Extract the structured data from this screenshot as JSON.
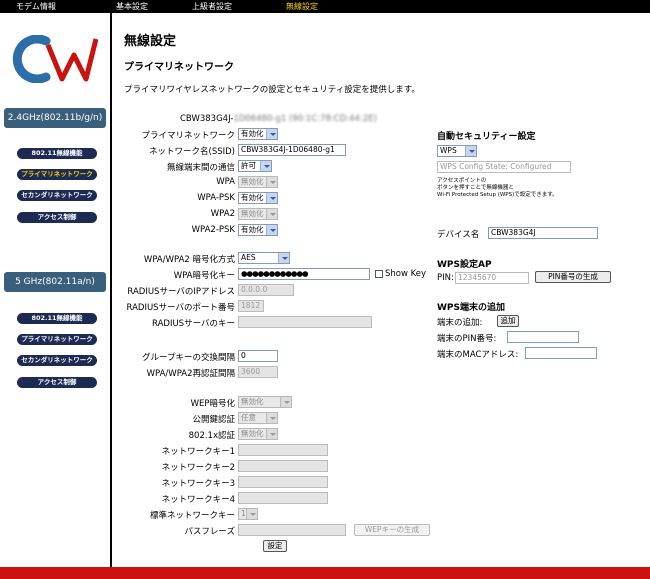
{
  "topnav": {
    "items": [
      "モデム情報",
      "基本設定",
      "上級者設定",
      "無線設定"
    ]
  },
  "logo": {
    "text": "CW",
    "color_c": "#2e6ea8",
    "color_w": "#cc1111"
  },
  "sidebar": {
    "band_24": "2.4GHz(802.11b/g/n)",
    "band_5": "5 GHz(802.11a/n)",
    "items_24": [
      "802.11無線機能",
      "プライマリネットワーク",
      "セカンダリネットワーク",
      "アクセス制御"
    ],
    "items_5": [
      "802.11無線機能",
      "プライマリネットワーク",
      "セカンダリネットワーク",
      "アクセス制御"
    ]
  },
  "page": {
    "title": "無線設定",
    "subtitle": "プライマリネットワーク",
    "description": "プライマリワイヤレスネットワークの設定とセキュリティ設定を提供します。"
  },
  "form": {
    "device_id_prefix": "CBW383G4J-",
    "device_id_blurred": "1D06480-g1 (90:1C:78:CD:44:2E)",
    "primary_network": {
      "label": "プライマリネットワーク",
      "value": "有効化"
    },
    "ssid": {
      "label": "ネットワーク名(SSID)",
      "value": "CBW383G4J-1D06480-g1"
    },
    "inter_client": {
      "label": "無線端末間の通信",
      "value": "許可"
    },
    "wpa": {
      "label": "WPA",
      "value": "無効化"
    },
    "wpa_psk": {
      "label": "WPA-PSK",
      "value": "有効化"
    },
    "wpa2": {
      "label": "WPA2",
      "value": "無効化"
    },
    "wpa2_psk": {
      "label": "WPA2-PSK",
      "value": "有効化"
    },
    "encryption": {
      "label": "WPA/WPA2 暗号化方式",
      "value": "AES"
    },
    "wpa_key": {
      "label": "WPA暗号化キー",
      "value": "●●●●●●●●●●●●"
    },
    "show_key": "Show Key",
    "radius_ip": {
      "label": "RADIUSサーバのIPアドレス",
      "value": "0.0.0.0"
    },
    "radius_port": {
      "label": "RADIUSサーバのポート番号",
      "value": "1812"
    },
    "radius_key": {
      "label": "RADIUSサーバのキー",
      "value": ""
    },
    "group_key_interval": {
      "label": "グループキーの交換間隔",
      "value": "0"
    },
    "reauth_interval": {
      "label": "WPA/WPA2再認証間隔",
      "value": "3600"
    },
    "wep_encryption": {
      "label": "WEP暗号化",
      "value": "無効化"
    },
    "shared_key_auth": {
      "label": "公開鍵認証",
      "value": "任意"
    },
    "dot1x": {
      "label": "802.1x認証",
      "value": "無効化"
    },
    "key1_label": "ネットワークキー1",
    "key2_label": "ネットワークキー2",
    "key3_label": "ネットワークキー3",
    "key4_label": "ネットワークキー4",
    "default_key": {
      "label": "標準ネットワークキー",
      "value": "1"
    },
    "passphrase": {
      "label": "パスフレーズ"
    },
    "wep_generate_button": "WEPキーの生成",
    "apply_button": "設定"
  },
  "right": {
    "auto_security_title": "自動セキュリティー設定",
    "wps_select": "WPS",
    "wps_state": "WPS Config State: Configured",
    "note_line1": "アクセスポイントの",
    "note_line2": "ボタンを押すことで無線機器と",
    "note_line3": "Wi-Fi Protected Setup (WPS)で設定できます。",
    "device_name_label": "デバイス名",
    "device_name_value": "CBW383G4J",
    "wps_ap_title": "WPS設定AP",
    "pin_label": "PIN:",
    "pin_value": "12345670",
    "pin_button": "PIN番号の生成",
    "wps_add_title": "WPS端末の追加",
    "add_label": "端末の追加:",
    "add_button": "追加",
    "client_pin_label": "端末のPIN番号:",
    "client_mac_label": "端末のMACアドレス:"
  }
}
